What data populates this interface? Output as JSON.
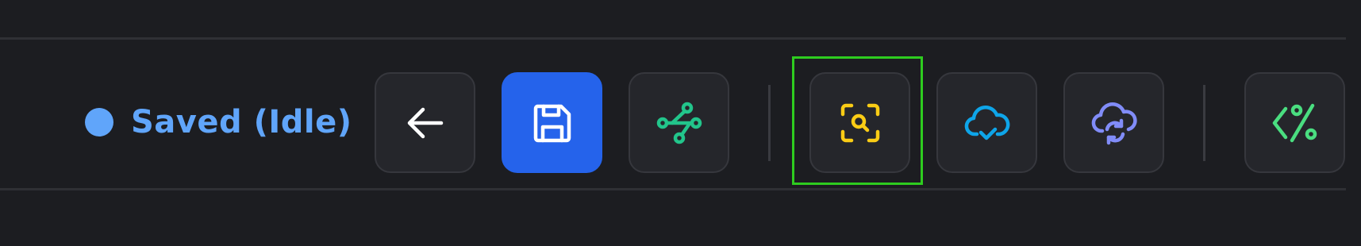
{
  "status": {
    "label": "Saved (Idle)",
    "dot_color": "#60a5fa",
    "text_color": "#60a5fa"
  },
  "toolbar": {
    "buttons": [
      {
        "id": "back",
        "icon": "arrow-left-icon",
        "color": "#ffffff",
        "primary": false
      },
      {
        "id": "save",
        "icon": "floppy-disk-icon",
        "color": "#ffffff",
        "primary": true
      },
      {
        "id": "connect",
        "icon": "network-branch-icon",
        "color": "#22c58b",
        "primary": false
      },
      {
        "id": "scan",
        "icon": "scan-search-icon",
        "color": "#facc15",
        "primary": false,
        "focused": true
      },
      {
        "id": "cloud-check",
        "icon": "cloud-check-icon",
        "color": "#0ea5e9",
        "primary": false
      },
      {
        "id": "cloud-sync",
        "icon": "cloud-sync-icon",
        "color": "#818cf8",
        "primary": false
      },
      {
        "id": "code-percent",
        "icon": "code-percent-icon",
        "color": "#4ade80",
        "primary": false
      }
    ]
  },
  "colors": {
    "background": "#1c1d21",
    "focus_ring": "#2ecc1f",
    "primary": "#2563eb"
  }
}
